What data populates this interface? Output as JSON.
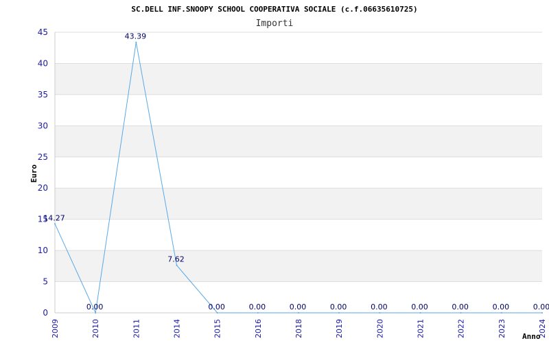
{
  "chart_data": {
    "type": "line",
    "title": "SC.DELL INF.SNOOPY SCHOOL COOPERATIVA SOCIALE (c.f.06635610725)",
    "subtitle": "Importi",
    "xlabel": "Anno",
    "ylabel": "Euro",
    "categories": [
      "2009",
      "2010",
      "2011",
      "2014",
      "2015",
      "2016",
      "2018",
      "2019",
      "2020",
      "2021",
      "2022",
      "2023",
      "2024"
    ],
    "values": [
      14.27,
      0,
      43.39,
      7.62,
      0,
      0,
      0,
      0,
      0,
      0,
      0,
      0,
      0
    ],
    "value_labels": [
      "14.27",
      "0.00",
      "43.39",
      "7.62",
      "0.00",
      "0.00",
      "0.00",
      "0.00",
      "0.00",
      "0.00",
      "0.00",
      "0.00",
      "0.00"
    ],
    "ylim": [
      0,
      45
    ],
    "yticks": [
      0,
      5,
      10,
      15,
      20,
      25,
      30,
      35,
      40,
      45
    ],
    "grid": true,
    "colors": {
      "line": "#5aa9e6",
      "band": "#f2f2f2",
      "grid": "#dddddd",
      "tick_text": "#1a1aa6"
    }
  }
}
